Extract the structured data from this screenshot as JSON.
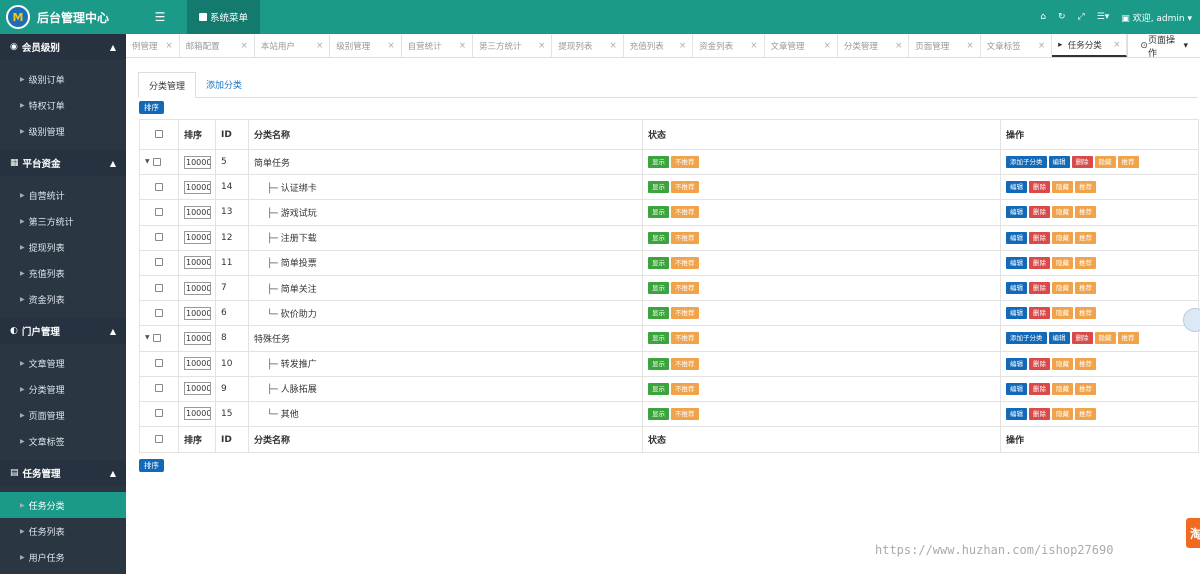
{
  "brand": {
    "title": "后台管理中心",
    "logo_icon": "logo-icon"
  },
  "topbar": {
    "system_menu": "系统菜单",
    "welcome": "欢迎, admin",
    "accent": "#1b9a8a"
  },
  "sidebar": {
    "groups": [
      {
        "label": "会员级别",
        "items": [
          "级别订单",
          "特权订单",
          "级别管理"
        ]
      },
      {
        "label": "平台资金",
        "items": [
          "自营统计",
          "第三方统计",
          "提现列表",
          "充值列表",
          "资金列表"
        ]
      },
      {
        "label": "门户管理",
        "items": [
          "文章管理",
          "分类管理",
          "页面管理",
          "文章标签"
        ]
      },
      {
        "label": "任务管理",
        "items": [
          "任务分类",
          "任务列表",
          "用户任务"
        ]
      }
    ],
    "active_item": "任务分类"
  },
  "tabs": [
    "例管理",
    "邮箱配置",
    "本站用户",
    "级别管理",
    "自营统计",
    "第三方统计",
    "提现列表",
    "充值列表",
    "资金列表",
    "文章管理",
    "分类管理",
    "页面管理",
    "文章标签",
    "任务分类"
  ],
  "page_ops": "页面操作",
  "subtabs": [
    "分类管理",
    "添加分类"
  ],
  "sort_btn": "排序",
  "table": {
    "headers": [
      "排序",
      "ID",
      "分类名称",
      "状态",
      "操作"
    ],
    "rows": [
      {
        "sort": "10000",
        "id": "5",
        "name": "简单任务",
        "parent": true,
        "prefix": ""
      },
      {
        "sort": "10000",
        "id": "14",
        "name": "认证绑卡",
        "parent": false,
        "prefix": "├─ "
      },
      {
        "sort": "10000",
        "id": "13",
        "name": "游戏试玩",
        "parent": false,
        "prefix": "├─ "
      },
      {
        "sort": "10000",
        "id": "12",
        "name": "注册下载",
        "parent": false,
        "prefix": "├─ "
      },
      {
        "sort": "10000",
        "id": "11",
        "name": "简单投票",
        "parent": false,
        "prefix": "├─ "
      },
      {
        "sort": "10000",
        "id": "7",
        "name": "简单关注",
        "parent": false,
        "prefix": "├─ "
      },
      {
        "sort": "10000",
        "id": "6",
        "name": "砍价助力",
        "parent": false,
        "prefix": "└─ "
      },
      {
        "sort": "10000",
        "id": "8",
        "name": "特殊任务",
        "parent": true,
        "prefix": ""
      },
      {
        "sort": "10000",
        "id": "10",
        "name": "转发推广",
        "parent": false,
        "prefix": "├─ "
      },
      {
        "sort": "10000",
        "id": "9",
        "name": "人脉拓展",
        "parent": false,
        "prefix": "├─ "
      },
      {
        "sort": "10000",
        "id": "15",
        "name": "其他",
        "parent": false,
        "prefix": "└─ "
      }
    ],
    "status_labels": [
      "显示",
      "不推荐"
    ],
    "action_labels": {
      "add_child": "添加子分类",
      "edit": "编辑",
      "delete": "删除",
      "hide": "隐藏",
      "recommend": "推荐"
    }
  },
  "watermark": "https://www.huzhan.com/ishop27690",
  "side_tag": "淘"
}
